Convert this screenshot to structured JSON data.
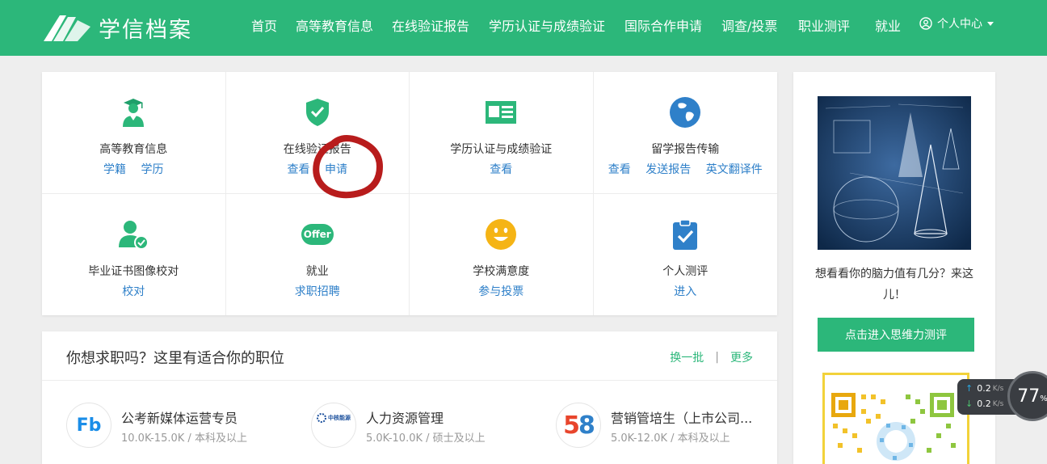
{
  "header": {
    "logo_text": "学信档案",
    "nav": [
      "首页",
      "高等教育信息",
      "在线验证报告",
      "学历认证与成绩验证",
      "国际合作申请",
      "调查/投票",
      "职业测评",
      "就业"
    ],
    "user_center": "个人中心"
  },
  "services": [
    {
      "title": "高等教育信息",
      "links": [
        "学籍",
        "学历"
      ],
      "icon": "graduate-icon"
    },
    {
      "title": "在线验证报告",
      "links": [
        "查看",
        "申请"
      ],
      "icon": "shield-check-icon"
    },
    {
      "title": "学历认证与成绩验证",
      "links": [
        "查看"
      ],
      "icon": "id-card-icon"
    },
    {
      "title": "留学报告传输",
      "links": [
        "查看",
        "发送报告",
        "英文翻译件"
      ],
      "icon": "globe-icon"
    },
    {
      "title": "毕业证书图像校对",
      "links": [
        "校对"
      ],
      "icon": "user-check-icon"
    },
    {
      "title": "就业",
      "links": [
        "求职招聘"
      ],
      "icon": "offer-icon",
      "icon_text": "Offer"
    },
    {
      "title": "学校满意度",
      "links": [
        "参与投票"
      ],
      "icon": "smiley-icon"
    },
    {
      "title": "个人测评",
      "links": [
        "进入"
      ],
      "icon": "clipboard-check-icon"
    }
  ],
  "jobs": {
    "title": "你想求职吗？这里有适合你的职位",
    "refresh": "换一批",
    "more": "更多",
    "items": [
      {
        "name": "公考新媒体运营专员",
        "salary": "10.0K-15.0K",
        "degree": "本科及以上",
        "logo_text": "Fb"
      },
      {
        "name": "人力资源管理",
        "salary": "5.0K-10.0K",
        "degree": "硕士及以上",
        "logo_text": "中核能源"
      },
      {
        "name": "营销管培生（上市公司...",
        "salary": "5.0K-12.0K",
        "degree": "本科及以上",
        "logo_text": "58"
      }
    ]
  },
  "sidebar": {
    "promo_text": "想看看你的脑力值有几分？来这儿！",
    "promo_button": "点击进入思维力测评"
  },
  "speed_widget": {
    "up": "0.2",
    "down": "0.2",
    "unit": "K/s",
    "percent": "77",
    "percent_sign": "%"
  },
  "colors": {
    "brand_green": "#2cb77a",
    "link_blue": "#2f80c9"
  }
}
